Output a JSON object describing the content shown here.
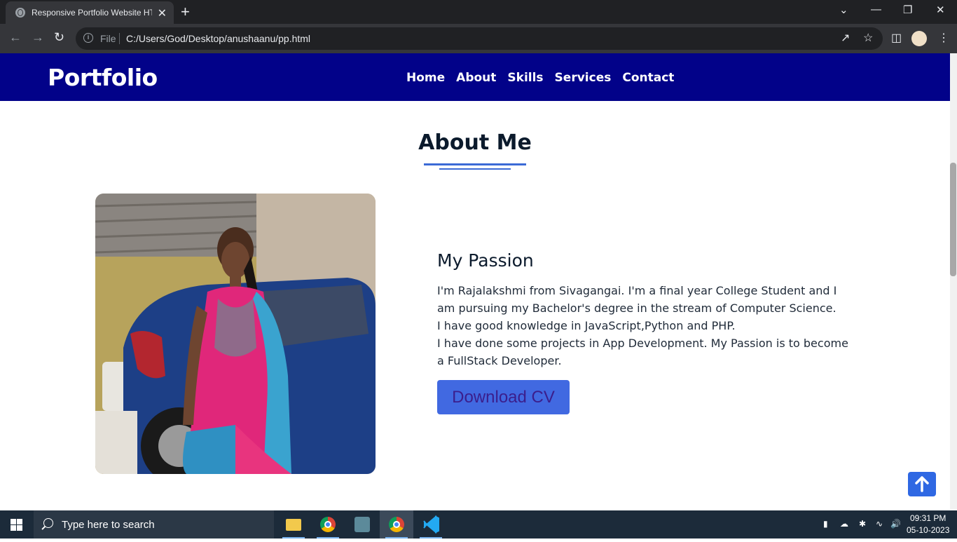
{
  "browser": {
    "tab_title": "Responsive Portfolio Website HT",
    "tab_close": "✕",
    "new_tab": "+",
    "window_controls": {
      "minimize": "—",
      "restore": "❐",
      "close": "✕",
      "dropdown": "⌄"
    },
    "file_label": "File",
    "url": "C:/Users/God/Desktop/anushaanu/pp.html"
  },
  "site": {
    "logo": "Portfolio",
    "nav": [
      "Home",
      "About",
      "Skills",
      "Services",
      "Contact"
    ]
  },
  "about": {
    "heading": "About Me",
    "subheading": "My Passion",
    "lines": [
      "I'm Rajalakshmi from Sivagangai. I'm a final year College Student and I am pursuing my Bachelor's degree in the stream of Computer Science.",
      "I have good knowledge in JavaScript,Python and PHP.",
      "I have done some projects in App Development. My Passion is to become a FullStack Developer."
    ],
    "cv_button": "Download CV"
  },
  "taskbar": {
    "search_placeholder": "Type here to search",
    "time": "09:31 PM",
    "date": "05-10-2023"
  },
  "colors": {
    "nav_bg": "#020289",
    "accent": "#4169e1",
    "scroll_top_bg": "#2f68e3"
  }
}
